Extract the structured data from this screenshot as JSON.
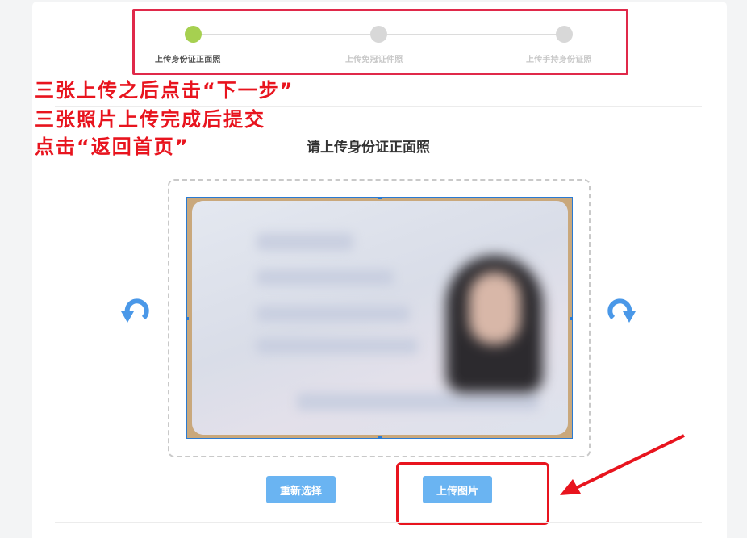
{
  "steps": {
    "items": [
      {
        "label": "上传身份证正面照",
        "state": "active"
      },
      {
        "label": "上传免冠证件照",
        "state": "pending"
      },
      {
        "label": "上传手持身份证照",
        "state": "pending"
      }
    ],
    "active_color": "#a6d050",
    "pending_color": "#d8d8d8"
  },
  "annotation": {
    "lines": [
      "三张上传之后点击“下一步”",
      "三张照片上传完成后提交",
      "点击“返回首页”"
    ],
    "color": "#e8141e"
  },
  "section": {
    "title": "请上传身份证正面照"
  },
  "buttons": {
    "reselect_label": "重新选择",
    "upload_label": "上传图片",
    "color": "#6ab4f2"
  },
  "icons": {
    "rotate_left": "rotate-left-icon",
    "rotate_right": "rotate-right-icon"
  }
}
